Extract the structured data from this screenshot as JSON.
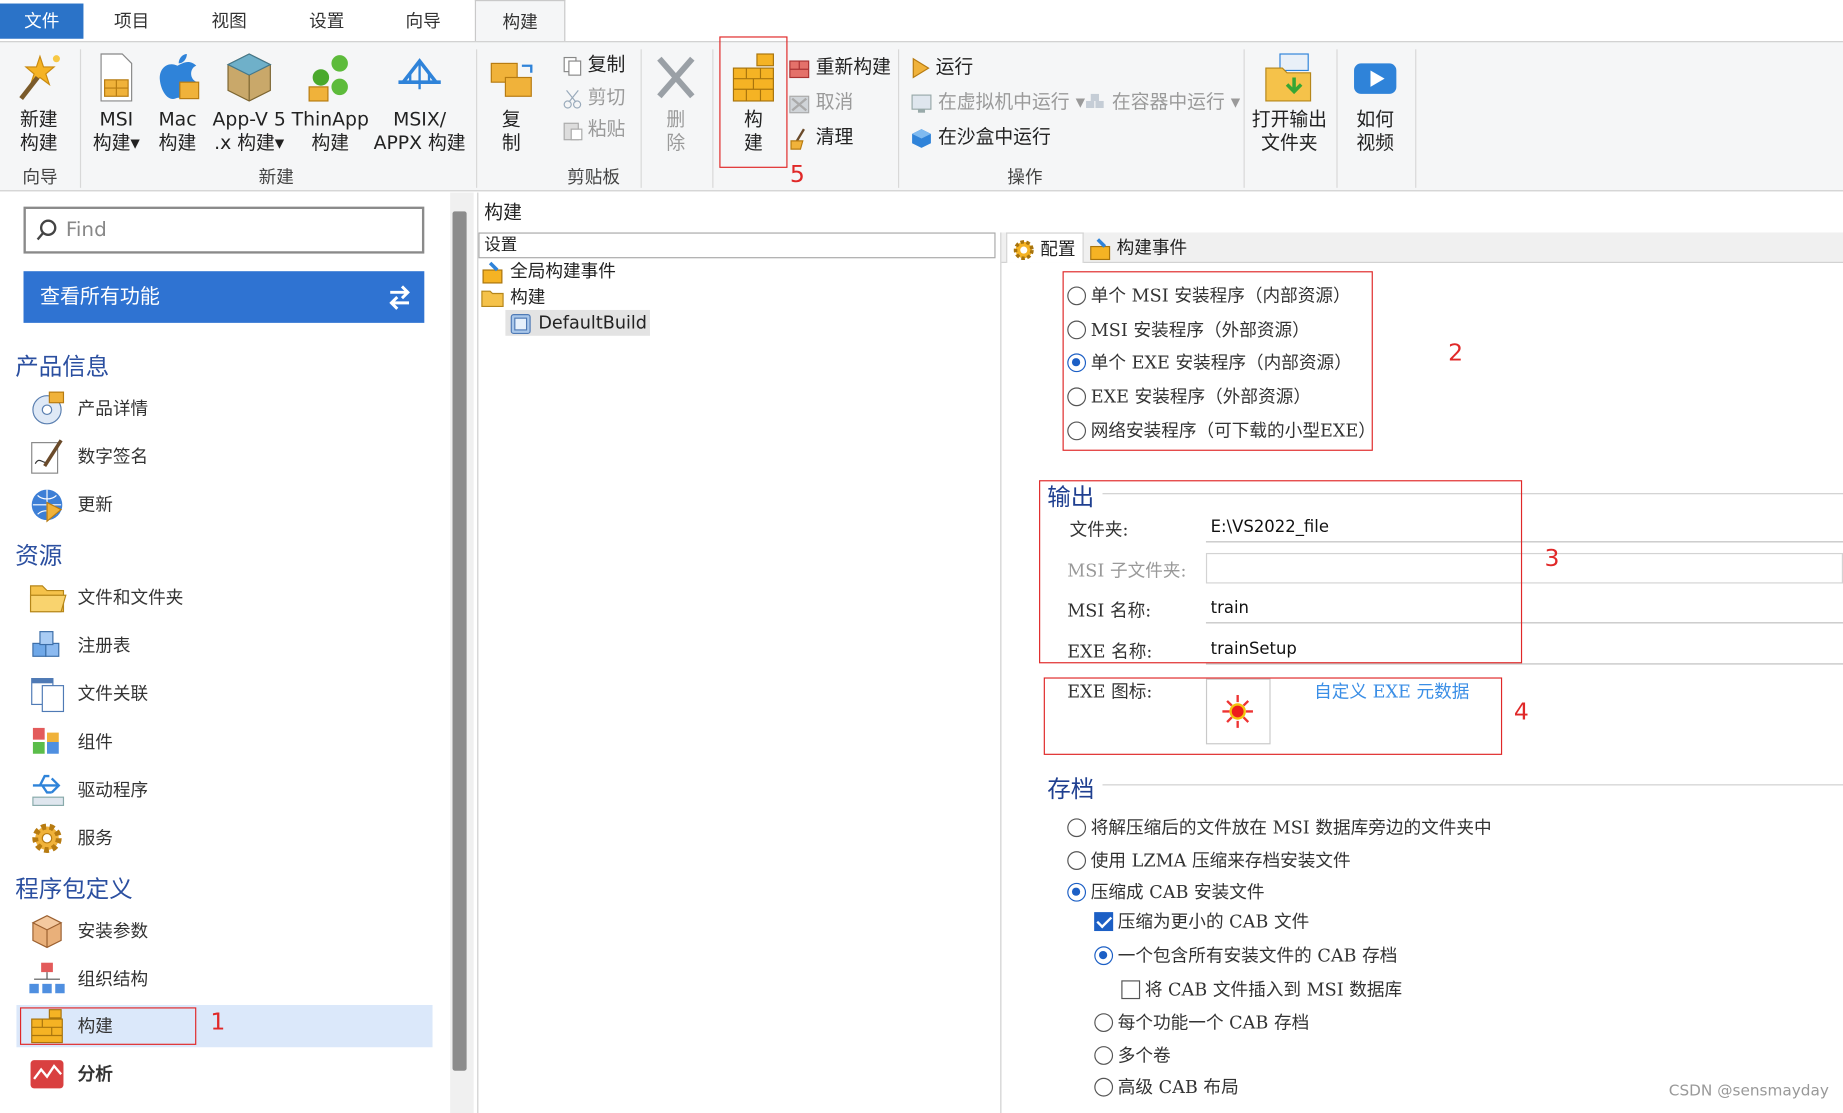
{
  "tabs": [
    "文件",
    "项目",
    "视图",
    "设置",
    "向导",
    "构建"
  ],
  "ribbon": {
    "wizard": {
      "btn_line1": "新建",
      "btn_line2": "构建",
      "group": "向导"
    },
    "new": {
      "msi": {
        "l1": "MSI",
        "l2": "构建▾"
      },
      "mac": {
        "l1": "Mac",
        "l2": "构建"
      },
      "appv": {
        "l1": "App-V 5",
        "l2": ".x 构建▾"
      },
      "thinapp": {
        "l1": "ThinApp",
        "l2": "构建"
      },
      "msix": {
        "l1": "MSIX/",
        "l2": "APPX 构建"
      },
      "group": "新建"
    },
    "clipboard": {
      "copy_big_l1": "复",
      "copy_big_l2": "制",
      "copy": "复制",
      "cut": "剪切",
      "paste": "粘贴",
      "group": "剪贴板"
    },
    "delete": {
      "l1": "删",
      "l2": "除"
    },
    "build": {
      "l1": "构",
      "l2": "建"
    },
    "ops": {
      "rebuild": "重新构建",
      "cancel": "取消",
      "clean": "清理",
      "run": "运行",
      "run_vm": "在虚拟机中运行 ▾",
      "run_container": "在容器中运行 ▾",
      "run_sandbox": "在沙盒中运行",
      "group": "操作"
    },
    "open_output": {
      "l1": "打开输出",
      "l2": "文件夹"
    },
    "video": {
      "l1": "如何",
      "l2": "视频"
    }
  },
  "left": {
    "search_placeholder": "Find",
    "all_features": "查看所有功能",
    "sections": [
      {
        "title": "产品信息",
        "items": [
          "产品详情",
          "数字签名",
          "更新"
        ]
      },
      {
        "title": "资源",
        "items": [
          "文件和文件夹",
          "注册表",
          "文件关联",
          "组件",
          "驱动程序",
          "服务"
        ]
      },
      {
        "title": "程序包定义",
        "items": [
          "安装参数",
          "组织结构",
          "构建",
          "分析"
        ]
      }
    ]
  },
  "middle": {
    "header": "构建",
    "tree_header": "设置",
    "tree": {
      "global_events": "全局构建事件",
      "builds": "构建",
      "default_build": "DefaultBuild"
    }
  },
  "right": {
    "tabs": {
      "config": "配置",
      "build_events": "构建事件"
    },
    "package_types": [
      {
        "label": "单个 MSI 安装程序（内部资源）",
        "selected": false
      },
      {
        "label": "MSI 安装程序（外部资源）",
        "selected": false
      },
      {
        "label": "单个 EXE 安装程序（内部资源）",
        "selected": true
      },
      {
        "label": "EXE 安装程序（外部资源）",
        "selected": false
      },
      {
        "label": "网络安装程序（可下载的小型EXE）",
        "selected": false
      }
    ],
    "output": {
      "title": "输出",
      "folder_label": "文件夹:",
      "folder_value": "E:\\VS2022_file",
      "msi_subfolder_label": "MSI 子文件夹:",
      "msi_subfolder_value": "",
      "msi_name_label": "MSI 名称:",
      "msi_name_value": "train",
      "exe_name_label": "EXE 名称:",
      "exe_name_value": "trainSetup",
      "exe_icon_label": "EXE 图标:",
      "custom_meta_link": "自定义 EXE 元数据"
    },
    "archive": {
      "title": "存档",
      "options": [
        {
          "label": "将解压缩后的文件放在 MSI 数据库旁边的文件夹中",
          "selected": false
        },
        {
          "label": "使用 LZMA 压缩来存档安装文件",
          "selected": false
        },
        {
          "label": "压缩成 CAB 安装文件",
          "selected": true
        }
      ],
      "smaller_cab": {
        "label": "压缩为更小的 CAB 文件",
        "checked": true
      },
      "cab_options": [
        {
          "label": "一个包含所有安装文件的 CAB 存档",
          "selected": true
        }
      ],
      "insert_cab": {
        "label": "将 CAB 文件插入到 MSI 数据库",
        "checked": false
      },
      "cab_options2": [
        {
          "label": "每个功能一个 CAB 存档",
          "selected": false
        },
        {
          "label": "多个卷",
          "selected": false
        },
        {
          "label": "高级 CAB 布局",
          "selected": false
        }
      ]
    }
  },
  "annotations": [
    "1",
    "2",
    "3",
    "4",
    "5"
  ],
  "watermark": "CSDN @sensmayday",
  "colors": {
    "accent": "#2b73c8",
    "annotation_red": "#e02828",
    "section_blue": "#1f3f90"
  }
}
